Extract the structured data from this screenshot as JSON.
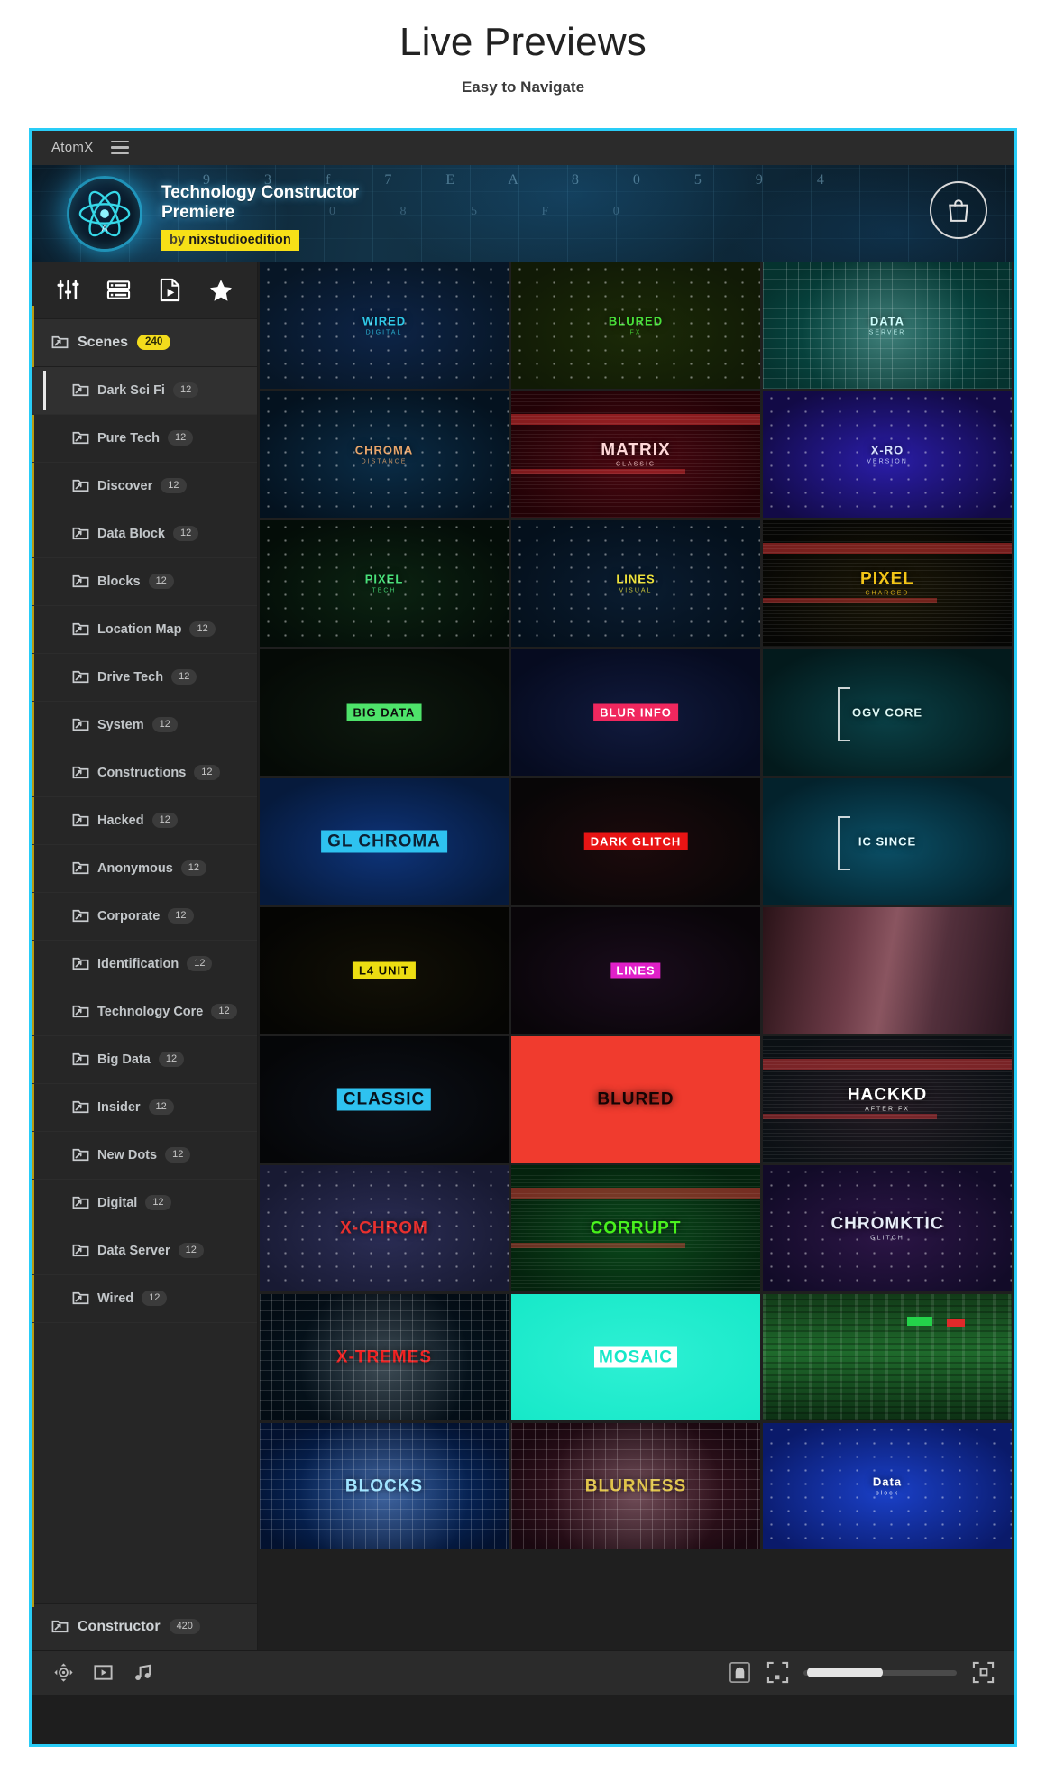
{
  "page": {
    "title": "Live Previews",
    "subtitle": "Easy to Navigate"
  },
  "app": {
    "titlebar": {
      "brand": "AtomX",
      "menu_icon": "hamburger-menu-icon"
    },
    "hero": {
      "logo_icon": "atom-logo-icon",
      "title_line1": "Technology Constructor",
      "title_line2": "Premiere",
      "badge_prefix": "by",
      "badge_author": "nixstudioedition",
      "cart_icon": "shopping-bag-icon",
      "glyph_row1": "9 3 f 7 E A 8 0 5 9 4",
      "glyph_row2": "0 8 5 F 0"
    },
    "tabs": [
      {
        "name": "tab-sliders",
        "icon": "sliders-icon"
      },
      {
        "name": "tab-list",
        "icon": "list-layout-icon"
      },
      {
        "name": "tab-media",
        "icon": "media-file-icon"
      },
      {
        "name": "tab-favorites",
        "icon": "star-icon"
      }
    ],
    "scenes": {
      "label": "Scenes",
      "count": "240",
      "icon": "folder-share-icon"
    },
    "categories": [
      {
        "label": "Dark Sci Fi",
        "count": "12",
        "selected": true
      },
      {
        "label": "Pure Tech",
        "count": "12",
        "selected": false
      },
      {
        "label": "Discover",
        "count": "12",
        "selected": false
      },
      {
        "label": "Data Block",
        "count": "12",
        "selected": false
      },
      {
        "label": "Blocks",
        "count": "12",
        "selected": false
      },
      {
        "label": "Location Map",
        "count": "12",
        "selected": false
      },
      {
        "label": "Drive Tech",
        "count": "12",
        "selected": false
      },
      {
        "label": "System",
        "count": "12",
        "selected": false
      },
      {
        "label": "Constructions",
        "count": "12",
        "selected": false
      },
      {
        "label": "Hacked",
        "count": "12",
        "selected": false
      },
      {
        "label": "Anonymous",
        "count": "12",
        "selected": false
      },
      {
        "label": "Corporate",
        "count": "12",
        "selected": false
      },
      {
        "label": "Identification",
        "count": "12",
        "selected": false
      },
      {
        "label": "Technology Core",
        "count": "12",
        "selected": false
      },
      {
        "label": "Big Data",
        "count": "12",
        "selected": false
      },
      {
        "label": "Insider",
        "count": "12",
        "selected": false
      },
      {
        "label": "New Dots",
        "count": "12",
        "selected": false
      },
      {
        "label": "Digital",
        "count": "12",
        "selected": false
      },
      {
        "label": "Data Server",
        "count": "12",
        "selected": false
      },
      {
        "label": "Wired",
        "count": "12",
        "selected": false
      }
    ],
    "constructor": {
      "label": "Constructor",
      "count": "420",
      "icon": "folder-share-icon"
    },
    "footer": {
      "left_icons": [
        {
          "name": "transform-icon"
        },
        {
          "name": "play-box-icon"
        },
        {
          "name": "music-note-icon"
        }
      ],
      "right_icons": [
        {
          "name": "bag-preview-icon"
        },
        {
          "name": "fit-to-frame-icon"
        },
        {
          "name": "grid-size-icon"
        }
      ],
      "zoom_label": ""
    },
    "previews": [
      {
        "title": "WIRED",
        "subtitle": "DIGITAL",
        "color": "#2fc9e8",
        "bg1": "#071626",
        "bg2": "#0d2447",
        "style": "dots"
      },
      {
        "title": "BLURED",
        "subtitle": "FX",
        "color": "#49e03a",
        "bg1": "#111a06",
        "bg2": "#1b2a07",
        "style": "dots"
      },
      {
        "title": "DATA",
        "subtitle": "SERVER",
        "color": "#cdfdfb",
        "bg1": "#05332f",
        "bg2": "#0a5c55",
        "style": "mesh"
      },
      {
        "title": "CHROMA",
        "subtitle": "DISTANCE",
        "color": "#e8a56a",
        "bg1": "#04121f",
        "bg2": "#0a2c46",
        "style": "dots"
      },
      {
        "title": "MATRIX",
        "subtitle": "CLASSIC",
        "color": "#ffd7d7",
        "bg1": "#220206",
        "bg2": "#4a0710",
        "style": "scan"
      },
      {
        "title": "X-RO",
        "subtitle": "VERSION",
        "color": "#d8e4ff",
        "bg1": "#120a46",
        "bg2": "#2a1da8",
        "style": "dots"
      },
      {
        "title": "PIXEL",
        "subtitle": "TECH",
        "color": "#49e07a",
        "bg1": "#040d08",
        "bg2": "#0b2311",
        "style": "dots"
      },
      {
        "title": "LINES",
        "subtitle": "VISUAL",
        "color": "#ece03b",
        "bg1": "#04101c",
        "bg2": "#0a1c30",
        "style": "dots"
      },
      {
        "title": "PIXEL",
        "subtitle": "CHARGED",
        "color": "#f2c415",
        "bg1": "#060604",
        "bg2": "#1a1606",
        "style": "scan"
      },
      {
        "title": "BIG DATA",
        "subtitle": "",
        "color": "#0d0d0d",
        "bg1": "#050a06",
        "bg2": "#0d180e",
        "style": "boxgreen"
      },
      {
        "title": "BLUR INFO",
        "subtitle": "",
        "color": "#ffffff",
        "bg1": "#060b20",
        "bg2": "#111a3d",
        "style": "boxpink"
      },
      {
        "title": "OGV CORE",
        "subtitle": "",
        "color": "#dff7f4",
        "bg1": "#031a1c",
        "bg2": "#0a4046",
        "style": "bracket"
      },
      {
        "title": "GL CHROMA",
        "subtitle": "",
        "color": "#0c2033",
        "bg1": "#061a3c",
        "bg2": "#0e347a",
        "style": "boxcyan"
      },
      {
        "title": "DARK GLITCH",
        "subtitle": "",
        "color": "#ffffff",
        "bg1": "#080607",
        "bg2": "#1c0a0c",
        "style": "boxred"
      },
      {
        "title": "IC SINCE",
        "subtitle": "",
        "color": "#e4fbff",
        "bg1": "#03222c",
        "bg2": "#0b4f66",
        "style": "bracket"
      },
      {
        "title": "L4 UNIT",
        "subtitle": "",
        "color": "#101000",
        "bg1": "#050503",
        "bg2": "#121006",
        "style": "boxyellow"
      },
      {
        "title": "LINES",
        "subtitle": "",
        "color": "#ffffff",
        "bg1": "#090509",
        "bg2": "#1a0c1c",
        "style": "boxmagenta"
      },
      {
        "title": "",
        "subtitle": "",
        "color": "#ffffff",
        "bg1": "#2a1318",
        "bg2": "#7b4450",
        "style": "mosaicblur"
      },
      {
        "title": "CLASSIC",
        "subtitle": "",
        "color": "#08121c",
        "bg1": "#050608",
        "bg2": "#0c1018",
        "style": "boxcyan"
      },
      {
        "title": "BLURED",
        "subtitle": "",
        "color": "#140404",
        "bg1": "#f03b2e",
        "bg2": "#f8473a",
        "style": "flatred"
      },
      {
        "title": "HACKKD",
        "subtitle": "AFTER FX",
        "color": "#ffffff",
        "bg1": "#0b1014",
        "bg2": "#221a22",
        "style": "scan"
      },
      {
        "title": "X-CHROM",
        "subtitle": "",
        "color": "#e8302e",
        "bg1": "#181a33",
        "bg2": "#2b2d55",
        "style": "dots"
      },
      {
        "title": "CORRUPT",
        "subtitle": "",
        "color": "#45f018",
        "bg1": "#04220d",
        "bg2": "#0a4a1b",
        "style": "scan"
      },
      {
        "title": "CHROMKTIC",
        "subtitle": "GLITCH",
        "color": "#e6edf7",
        "bg1": "#120b28",
        "bg2": "#2c1546",
        "style": "dots"
      },
      {
        "title": "X-TREMES",
        "subtitle": "",
        "color": "#f02020",
        "bg1": "#030c14",
        "bg2": "#081a26",
        "style": "mesh"
      },
      {
        "title": "MOSAIC",
        "subtitle": "",
        "color": "#ffffff",
        "bg1": "#16e8c8",
        "bg2": "#2ef0d4",
        "style": "flatcyan"
      },
      {
        "title": "",
        "subtitle": "",
        "color": "#ffffff",
        "bg1": "#0a2a12",
        "bg2": "#1c5a28",
        "style": "glitchgreen"
      },
      {
        "title": "BLOCKS",
        "subtitle": "",
        "color": "#9fe4ff",
        "bg1": "#031230",
        "bg2": "#0a3a86",
        "style": "mesh"
      },
      {
        "title": "BLURNESS",
        "subtitle": "",
        "color": "#e0c44a",
        "bg1": "#1a0810",
        "bg2": "#4a1c2a",
        "style": "mesh"
      },
      {
        "title": "Data",
        "subtitle": "block",
        "color": "#ffffff",
        "bg1": "#0a1a6a",
        "bg2": "#1a40c8",
        "style": "dots"
      }
    ]
  }
}
